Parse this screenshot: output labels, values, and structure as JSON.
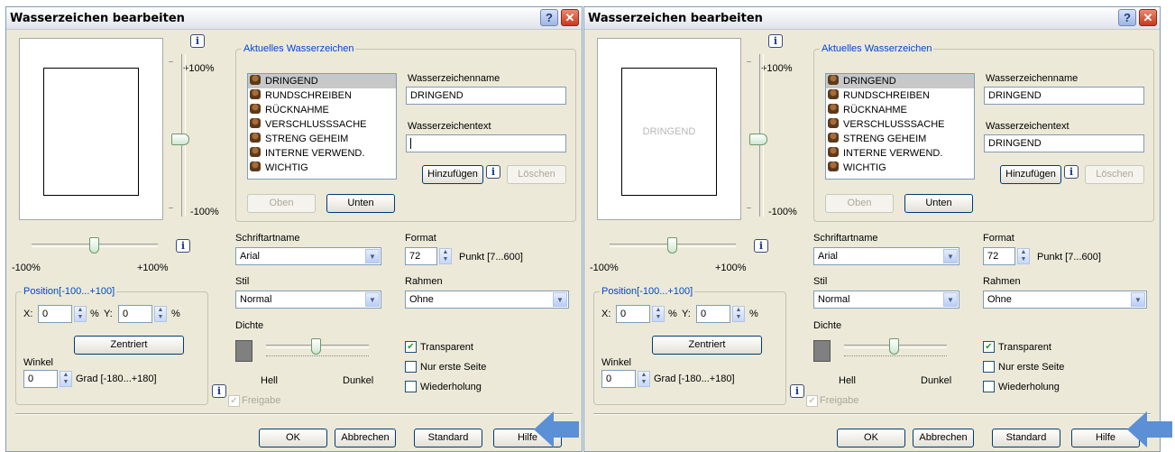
{
  "dialogs": [
    {
      "title": "Wasserzeichen bearbeiten",
      "preview_text": "",
      "slider_top": "+100%",
      "slider_bottom": "-100%",
      "hslider_left": "-100%",
      "hslider_right": "+100%",
      "group_current": "Aktuelles Wasserzeichen",
      "watermarks": [
        "DRINGEND",
        "RUNDSCHREIBEN",
        "RÜCKNAHME",
        "VERSCHLUSSSACHE",
        "STRENG GEHEIM",
        "INTERNE VERWEND.",
        "WICHTIG"
      ],
      "name_label": "Wasserzeichenname",
      "name_value": "DRINGEND",
      "text_label": "Wasserzeichentext",
      "text_value": "",
      "add_btn": "Hinzufügen",
      "delete_btn": "Löschen",
      "up_btn": "Oben",
      "down_btn": "Unten",
      "position_group": "Position[-100...+100]",
      "x_label": "X:",
      "x_value": "0",
      "y_label": "Y:",
      "y_value": "0",
      "percent": "%",
      "center_btn": "Zentriert",
      "angle_label": "Winkel",
      "angle_value": "0",
      "angle_unit": "Grad [-180...+180]",
      "font_label": "Schriftartname",
      "font_value": "Arial",
      "size_label": "Format",
      "size_value": "72",
      "size_unit": "Punkt [7...600]",
      "style_label": "Stil",
      "style_value": "Normal",
      "frame_label": "Rahmen",
      "frame_value": "Ohne",
      "density_label": "Dichte",
      "density_left": "Hell",
      "density_right": "Dunkel",
      "transparent": "Transparent",
      "first_page": "Nur erste Seite",
      "repeat": "Wiederholung",
      "release": "Freigabe",
      "ok_btn": "OK",
      "cancel_btn": "Abbrechen",
      "standard_btn": "Standard",
      "help_btn": "Hilfe"
    },
    {
      "title": "Wasserzeichen bearbeiten",
      "preview_text": "DRINGEND",
      "slider_top": "+100%",
      "slider_bottom": "-100%",
      "hslider_left": "-100%",
      "hslider_right": "+100%",
      "group_current": "Aktuelles Wasserzeichen",
      "watermarks": [
        "DRINGEND",
        "RUNDSCHREIBEN",
        "RÜCKNAHME",
        "VERSCHLUSSSACHE",
        "STRENG GEHEIM",
        "INTERNE VERWEND.",
        "WICHTIG"
      ],
      "name_label": "Wasserzeichenname",
      "name_value": "DRINGEND",
      "text_label": "Wasserzeichentext",
      "text_value": "DRINGEND",
      "add_btn": "Hinzufügen",
      "delete_btn": "Löschen",
      "up_btn": "Oben",
      "down_btn": "Unten",
      "position_group": "Position[-100...+100]",
      "x_label": "X:",
      "x_value": "0",
      "y_label": "Y:",
      "y_value": "0",
      "percent": "%",
      "center_btn": "Zentriert",
      "angle_label": "Winkel",
      "angle_value": "0",
      "angle_unit": "Grad [-180...+180]",
      "font_label": "Schriftartname",
      "font_value": "Arial",
      "size_label": "Format",
      "size_value": "72",
      "size_unit": "Punkt [7...600]",
      "style_label": "Stil",
      "style_value": "Normal",
      "frame_label": "Rahmen",
      "frame_value": "Ohne",
      "density_label": "Dichte",
      "density_left": "Hell",
      "density_right": "Dunkel",
      "transparent": "Transparent",
      "first_page": "Nur erste Seite",
      "repeat": "Wiederholung",
      "release": "Freigabe",
      "ok_btn": "OK",
      "cancel_btn": "Abbrechen",
      "standard_btn": "Standard",
      "help_btn": "Hilfe"
    }
  ],
  "colors": {
    "highlight_arrow": "#5b8fd6",
    "group_label": "#0046d5",
    "dialog_bg": "#ece9d8"
  },
  "icons": {
    "help": "question-mark",
    "close": "x",
    "info": "i",
    "watermark_item": "stamp-icon"
  }
}
